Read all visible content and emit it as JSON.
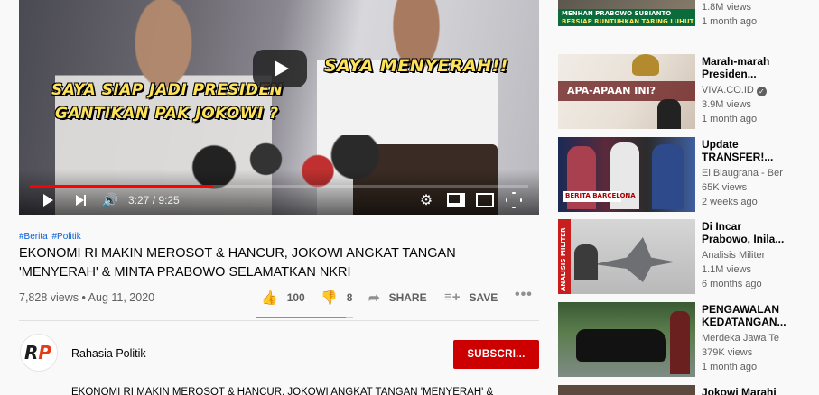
{
  "player": {
    "overlay_line1": "SAYA SIAP JADI PRESIDEN",
    "overlay_line2": "GANTIKAN PAK JOKOWI ?",
    "overlay_right": "SAYA MENYERAH!!",
    "time": "3:27 / 9:25",
    "progress": 0.367
  },
  "video": {
    "hashtags": [
      "#Berita",
      "#Politik"
    ],
    "title_line1": "EKONOMI RI MAKIN MEROSOT & HANCUR, JOKOWI ANGKAT TANGAN",
    "title_line2": "'MENYERAH' & MINTA PRABOWO SELAMATKAN NKRI",
    "views": "7,828 views",
    "date": "Aug 11, 2020",
    "likes": "100",
    "dislikes": "8",
    "like_ratio": 0.926,
    "share_label": "SHARE",
    "save_label": "SAVE",
    "more_label": "•••"
  },
  "channel": {
    "name": "Rahasia Politik",
    "avatar_text_dark": "R",
    "avatar_text_accent": "P",
    "subscribe_label": "SUBSCRI..."
  },
  "description": "EKONOMI RI MAKIN MEROSOT & HANCUR, JOKOWI ANGKAT TANGAN 'MENYERAH' &",
  "sidebar": [
    {
      "title": "",
      "channel": "",
      "views": "1.8M views",
      "age": "1 month ago",
      "thumb_caption1": "MENHAN PRABOWO SUBIANTO",
      "thumb_caption2": "BERSIAP RUNTUHKAN TARING LUHUT"
    },
    {
      "title_line1": "Marah-marah",
      "title_line2": "Presiden...",
      "channel": "VIVA.CO.ID",
      "verified": true,
      "views": "3.9M views",
      "age": "1 month ago",
      "thumb_caption": "APA-APAAN INI?"
    },
    {
      "title_line1": "Update",
      "title_line2": "TRANSFER!...",
      "channel": "El Blaugrana - Ber",
      "views": "65K views",
      "age": "2 weeks ago",
      "thumb_caption": "BERITA BARCELONA"
    },
    {
      "title_line1": "Di Incar",
      "title_line2": "Prabowo, Inila...",
      "channel": "Analisis Militer",
      "views": "1.1M views",
      "age": "6 months ago",
      "thumb_caption": "ANALISIS MILITER"
    },
    {
      "title_line1": "PENGAWALAN",
      "title_line2": "KEDATANGAN...",
      "channel": "Merdeka Jawa Te",
      "views": "379K views",
      "age": "1 month ago"
    },
    {
      "title_line1": "Jokowi Marahi"
    }
  ],
  "colors": {
    "accent_red": "#cc0000",
    "progress_red": "#ff0000",
    "link_blue": "#065fd4",
    "overlay_yellow": "#fde25a"
  }
}
